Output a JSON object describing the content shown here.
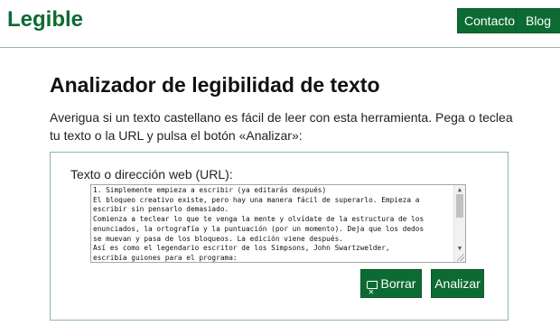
{
  "brand": "Legible",
  "nav": {
    "contacto": "Contacto",
    "blog": "Blog"
  },
  "page": {
    "title": "Analizador de legibilidad de texto",
    "intro": "Averigua si un texto castellano es fácil de leer con esta herramienta. Pega o teclea tu texto o la URL y pulsa el botón «Analizar»:"
  },
  "form": {
    "label": "Texto o dirección web (URL):",
    "text_lines": [
      "1. Simplemente empieza a escribir (ya editarás después)",
      "El bloqueo creativo existe, pero hay una manera fácil de superarlo. Empieza a",
      "escribir sin pensarlo demasiado.",
      "Comienza a teclear lo que te venga la mente y olvídate de la estructura de los",
      "enunciados, la ortografía y la puntuación (por un momento). Deja que los dedos",
      "se muevan y pasa de los bloqueos. La edición viene después.",
      "Así es como el legendario escritor de los Simpsons, John Swartzwelder,",
      "escribía guiones para el programa:"
    ],
    "clear_label": "Borrar",
    "analyze_label": "Analizar"
  },
  "colors": {
    "brand_green": "#0c6b32",
    "spell_underline": "#d33333"
  },
  "icons": {
    "clear": "eraser-icon"
  }
}
